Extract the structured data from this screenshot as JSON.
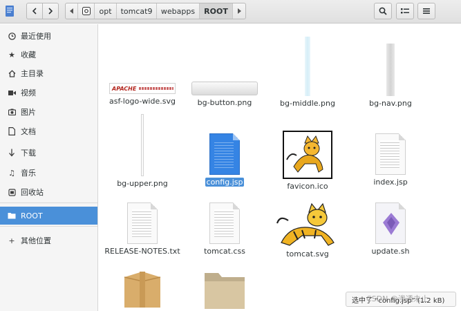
{
  "header": {
    "path": [
      "opt",
      "tomcat9",
      "webapps",
      "ROOT"
    ],
    "icons": {
      "back": "chevron-left",
      "forward": "chevron-right",
      "left_arrow": "triangle-left",
      "right_arrow": "triangle-right",
      "search": "search",
      "view": "list-view",
      "menu": "hamburger"
    }
  },
  "sidebar": {
    "items": [
      {
        "label": "最近使用",
        "icon": "clock"
      },
      {
        "label": "收藏",
        "icon": "star"
      },
      {
        "label": "主目录",
        "icon": "home"
      },
      {
        "label": "视频",
        "icon": "video"
      },
      {
        "label": "图片",
        "icon": "camera"
      },
      {
        "label": "文档",
        "icon": "document"
      },
      {
        "label": "下载",
        "icon": "download"
      },
      {
        "label": "音乐",
        "icon": "music"
      },
      {
        "label": "回收站",
        "icon": "trash"
      },
      {
        "label": "ROOT",
        "icon": "folder"
      },
      {
        "label": "其他位置",
        "icon": "plus"
      }
    ],
    "selected": "ROOT"
  },
  "files": [
    {
      "name": "asf-logo-wide.svg",
      "kind": "image"
    },
    {
      "name": "bg-button.png",
      "kind": "image"
    },
    {
      "name": "bg-middle.png",
      "kind": "image"
    },
    {
      "name": "bg-nav.png",
      "kind": "image"
    },
    {
      "name": "bg-upper.png",
      "kind": "image"
    },
    {
      "name": "config.jsp",
      "kind": "document",
      "selected": true
    },
    {
      "name": "favicon.ico",
      "kind": "image"
    },
    {
      "name": "index.jsp",
      "kind": "document"
    },
    {
      "name": "RELEASE-NOTES.txt",
      "kind": "document"
    },
    {
      "name": "tomcat.css",
      "kind": "document"
    },
    {
      "name": "tomcat.svg",
      "kind": "image"
    },
    {
      "name": "update.sh",
      "kind": "script"
    },
    {
      "name": "",
      "kind": "package"
    },
    {
      "name": "",
      "kind": "folder"
    }
  ],
  "asf_logo_text": "APACHE",
  "status_text": "选中了 “config.jsp” (1.2 kB)",
  "watermark": "CSDN @渗透未止",
  "colors": {
    "accent": "#4a90d9",
    "sidebar_bg": "#f5f5f5",
    "header_bg": "#e8e8e8"
  }
}
